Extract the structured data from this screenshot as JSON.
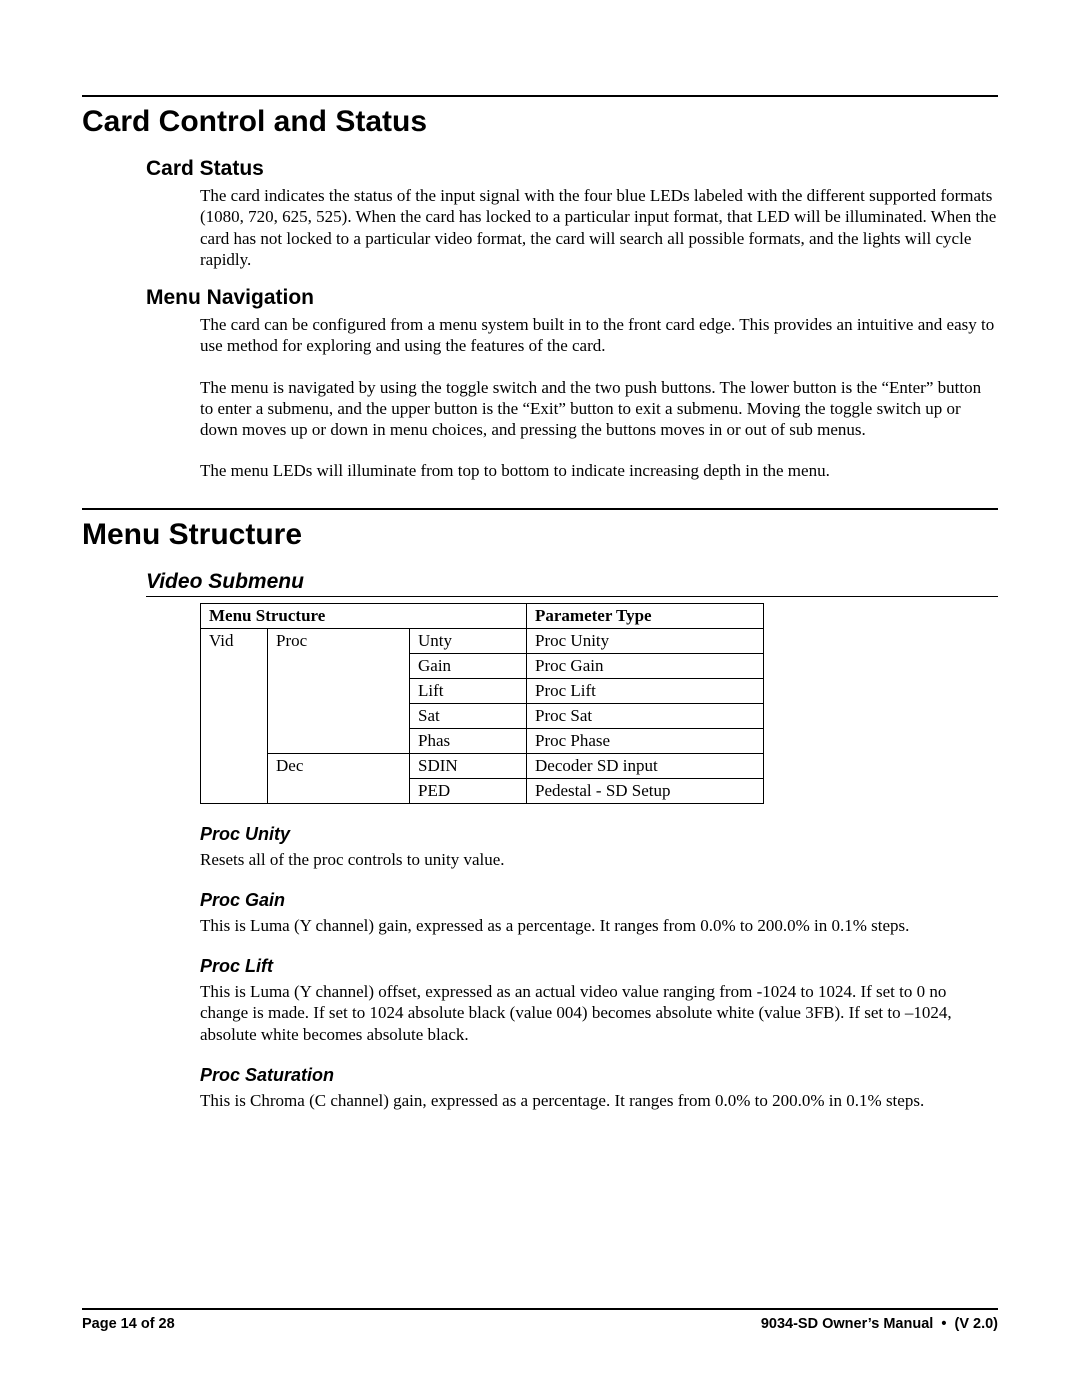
{
  "section1": {
    "title": "Card Control and Status",
    "sub1": {
      "heading": "Card Status",
      "p1": "The card indicates the status of the input signal with the four blue LEDs labeled with the different supported formats (1080, 720, 625, 525). When the card has locked to a particular input format, that LED will be illuminated. When the card has not locked to a particular video format, the card will search all possible formats, and the lights will cycle rapidly."
    },
    "sub2": {
      "heading": "Menu Navigation",
      "p1": "The card can be configured from a menu system built in to the front card edge. This provides an intuitive and easy to use method for exploring and using the features of the card.",
      "p2": "The menu is navigated by using the toggle switch and the two push buttons. The lower button is the “Enter” button to enter a submenu, and the upper button is the “Exit” button to exit a submenu. Moving the toggle switch up or down moves up or down in menu choices, and pressing the buttons moves in or out of sub menus.",
      "p3": "The menu LEDs will illuminate from top to bottom to indicate increasing depth in the menu."
    }
  },
  "section2": {
    "title": "Menu Structure",
    "sub1": {
      "heading": "Video Submenu",
      "table": {
        "header_left": "Menu Structure",
        "header_right": "Parameter Type",
        "rows": [
          {
            "a": "Vid",
            "b": "Proc",
            "c": "Unty",
            "d": "Proc Unity"
          },
          {
            "c": "Gain",
            "d": "Proc Gain"
          },
          {
            "c": "Lift",
            "d": "Proc Lift"
          },
          {
            "c": "Sat",
            "d": "Proc Sat"
          },
          {
            "c": "Phas",
            "d": "Proc Phase"
          },
          {
            "b": "Dec",
            "c": "SDIN",
            "d": "Decoder SD input"
          },
          {
            "c": "PED",
            "d": "Pedestal - SD Setup"
          }
        ]
      },
      "items": {
        "proc_unity": {
          "heading": "Proc Unity",
          "text": "Resets all of the proc controls to unity value."
        },
        "proc_gain": {
          "heading": "Proc Gain",
          "text": "This is Luma (Y channel) gain, expressed as a percentage. It ranges from 0.0% to 200.0% in 0.1% steps."
        },
        "proc_lift": {
          "heading": "Proc Lift",
          "text": "This is Luma (Y channel) offset, expressed as an actual video value ranging from -1024 to 1024. If set to 0 no change is made. If set to 1024 absolute black (value 004) becomes absolute white (value 3FB). If set to –1024, absolute white becomes absolute black."
        },
        "proc_saturation": {
          "heading": "Proc Saturation",
          "text": "This is Chroma (C channel) gain, expressed as a percentage. It ranges from 0.0% to 200.0% in 0.1% steps."
        }
      }
    }
  },
  "footer": {
    "left": "Page 14 of 28",
    "right": "9034-SD Owner’s Manual  •  (V 2.0)"
  }
}
